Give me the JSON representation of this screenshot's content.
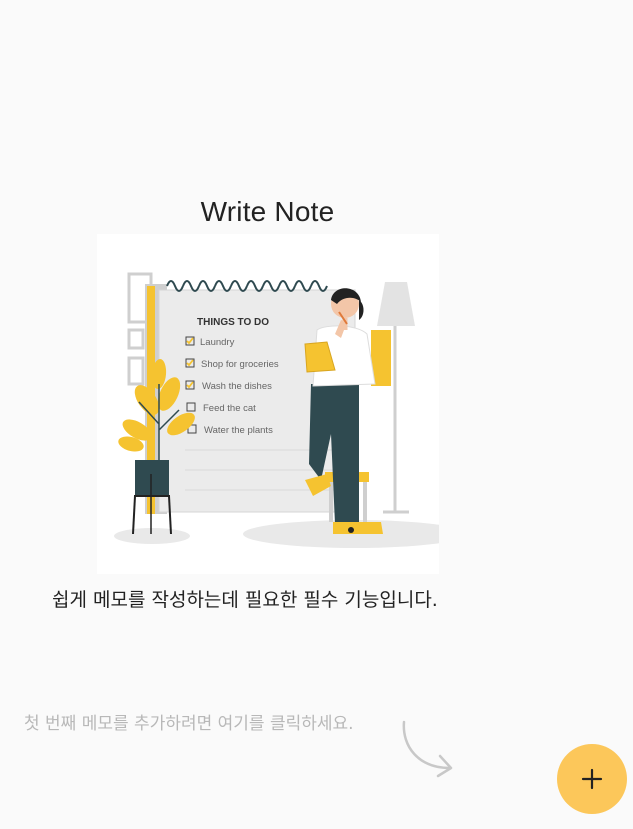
{
  "page": {
    "title": "Write Note",
    "subtitle": "쉽게 메모를 작성하는데 필요한 필수 기능입니다.",
    "hint": "첫 번째 메모를 추가하려면 여기를 클릭하세요."
  },
  "illustration": {
    "heading": "THINGS TO DO",
    "items": [
      {
        "label": "Laundry",
        "checked": true
      },
      {
        "label": "Shop for groceries",
        "checked": true
      },
      {
        "label": "Wash the dishes",
        "checked": true
      },
      {
        "label": "Feed the cat",
        "checked": false
      },
      {
        "label": "Water the plants",
        "checked": false
      }
    ]
  },
  "fab": {
    "icon": "plus-icon",
    "color": "#fcc75a"
  },
  "colors": {
    "accent": "#fcc75a",
    "illustration_yellow": "#f5c330",
    "illustration_dark": "#2f4a50"
  }
}
